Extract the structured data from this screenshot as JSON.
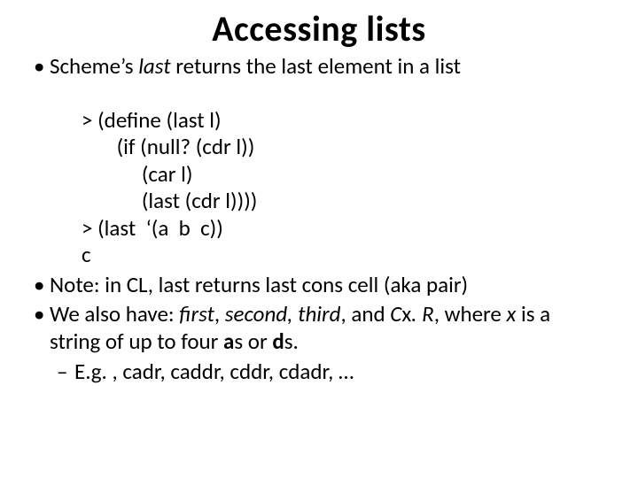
{
  "title": "Accessing lists",
  "bullets": {
    "b1_pre": "Scheme’s ",
    "b1_last": "last",
    "b1_post": " returns the last element in a list",
    "code_l1": "> (define (last l)",
    "code_l2": "       (if (null? (cdr l))",
    "code_l3": "            (car l)",
    "code_l4": "            (last (cdr l))))",
    "code_l5": "> (last  ‘(a  b  c))",
    "code_l6": "c",
    "b2": "Note: in CL, last returns last cons cell (aka pair)",
    "b3_pre": "We also have: ",
    "b3_first": "first",
    "b3_sep1": ", ",
    "b3_second": "second, third",
    "b3_sep2": ", and ",
    "b3_cxr_c": "C",
    "b3_cxr_x": "x",
    "b3_cxr_r": ". R",
    "b3_post1": ", where ",
    "b3_x": "x",
    "b3_post2": " is a string of up to four ",
    "b3_a": "a",
    "b3_post3": "s or ",
    "b3_d": "d",
    "b3_post4": "s.",
    "sub1": "E.g. , cadr, caddr, cddr, cdadr, …"
  },
  "glyphs": {
    "bullet": "•",
    "dash": "–"
  }
}
